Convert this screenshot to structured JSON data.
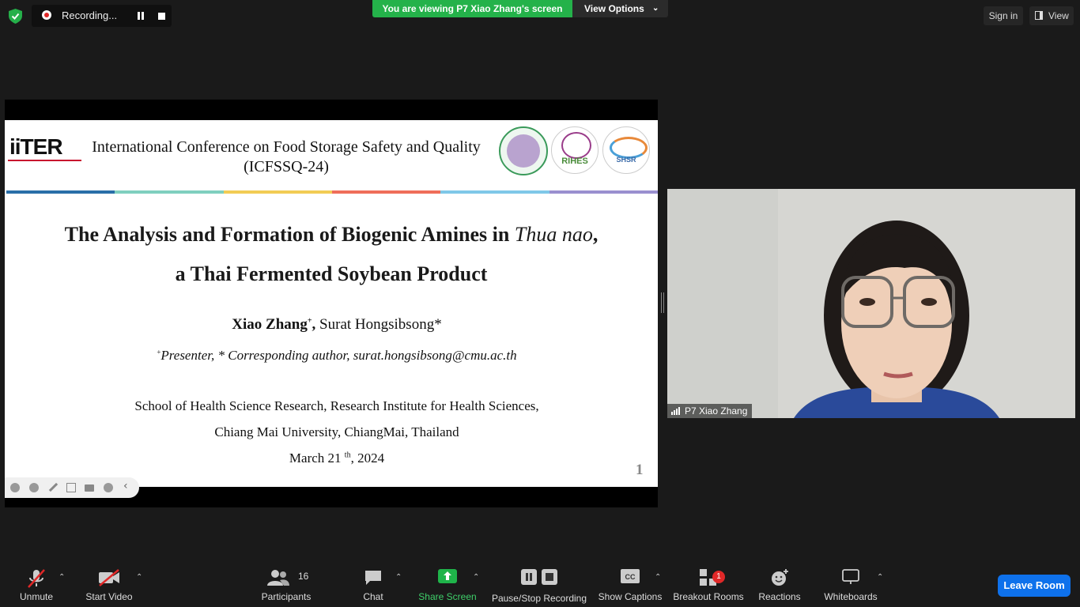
{
  "top_bar": {
    "recording_label": "Recording...",
    "viewing_banner": "You are viewing P7 Xiao Zhang's screen",
    "view_options_label": "View Options",
    "sign_in_label": "Sign in",
    "view_label": "View"
  },
  "slide": {
    "logo": "iiTER",
    "conference_title_line1": "International Conference on Food Storage Safety and Quality",
    "conference_title_line2": "(ICFSSQ-24)",
    "seal2_label": "RIHES",
    "seal3_label": "SHSR",
    "title_line1_a": "The Analysis and Formation of Biogenic Amines in ",
    "title_line1_italic": "Thua nao",
    "title_line1_b": ",",
    "title_line2": "a Thai Fermented Soybean Product",
    "author1": "Xiao Zhang",
    "author1_mark": "+",
    "author_sep": ",",
    "author2": " Surat Hongsibsong*",
    "note_mark": "+",
    "note_text": "Presenter,  * Corresponding author, surat.hongsibsong@cmu.ac.th",
    "affiliation_line1": "School of Health Science Research, Research Institute for Health Sciences,",
    "affiliation_line2": "Chiang Mai University, ChiangMai, Thailand",
    "date_a": "March 21 ",
    "date_sup": "th",
    "date_b": ", 2024",
    "page_number": "1",
    "accent_colors": [
      "#2a6fa8",
      "#7fcfbf",
      "#f2cc55",
      "#ef6e5a",
      "#7fc8e8",
      "#9a8fcf"
    ]
  },
  "video": {
    "participant_name": "P7 Xiao Zhang"
  },
  "bottom_bar": {
    "unmute_label": "Unmute",
    "start_video_label": "Start Video",
    "participants_label": "Participants",
    "participants_count": "16",
    "chat_label": "Chat",
    "share_screen_label": "Share Screen",
    "pause_stop_label": "Pause/Stop Recording",
    "captions_label": "Show Captions",
    "breakout_label": "Breakout Rooms",
    "breakout_badge": "1",
    "reactions_label": "Reactions",
    "whiteboards_label": "Whiteboards",
    "leave_label": "Leave Room"
  },
  "colors": {
    "banner_green": "#24b24a",
    "leave_blue": "#0e71eb",
    "share_green": "#1fb44a"
  }
}
